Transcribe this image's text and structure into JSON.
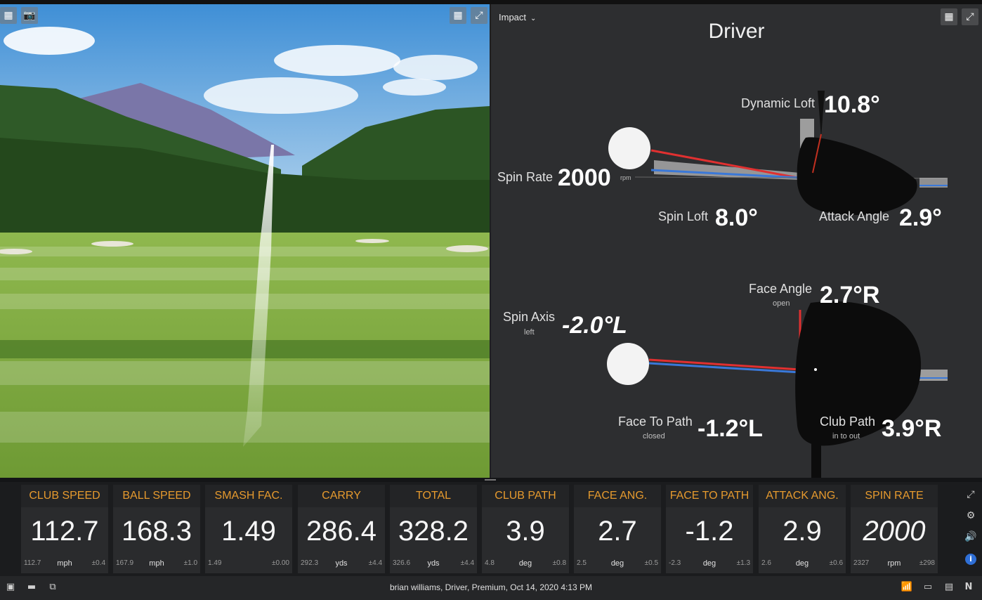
{
  "impact_panel": {
    "view_selector": "Impact",
    "club": "Driver",
    "side": {
      "dynamic_loft_label": "Dynamic Loft",
      "dynamic_loft_value": "10.8°",
      "spin_rate_label": "Spin Rate",
      "spin_rate_value": "2000",
      "spin_rate_unit": "rpm",
      "spin_loft_label": "Spin Loft",
      "spin_loft_value": "8.0°",
      "attack_angle_label": "Attack Angle",
      "attack_angle_value": "2.9°"
    },
    "top": {
      "face_angle_label": "Face Angle",
      "face_angle_sub": "open",
      "face_angle_value": "2.7°R",
      "spin_axis_label": "Spin Axis",
      "spin_axis_sub": "left",
      "spin_axis_value": "-2.0°L",
      "face_to_path_label": "Face To Path",
      "face_to_path_sub": "closed",
      "face_to_path_value": "-1.2°L",
      "club_path_label": "Club Path",
      "club_path_sub": "in to out",
      "club_path_value": "3.9°R"
    },
    "colors": {
      "face_line": "#e03030",
      "path_line": "#3a78d8",
      "panel_bg": "#2d2e30"
    }
  },
  "metrics": [
    {
      "label": "CLUB SPEED",
      "value": "112.7",
      "avg": "112.7",
      "unit": "mph",
      "dev": "±0.4"
    },
    {
      "label": "BALL SPEED",
      "value": "168.3",
      "avg": "167.9",
      "unit": "mph",
      "dev": "±1.0"
    },
    {
      "label": "SMASH FAC.",
      "value": "1.49",
      "avg": "1.49",
      "unit": "",
      "dev": "±0.00"
    },
    {
      "label": "CARRY",
      "value": "286.4",
      "avg": "292.3",
      "unit": "yds",
      "dev": "±4.4"
    },
    {
      "label": "TOTAL",
      "value": "328.2",
      "avg": "326.6",
      "unit": "yds",
      "dev": "±4.4"
    },
    {
      "label": "CLUB PATH",
      "value": "3.9",
      "avg": "4.8",
      "unit": "deg",
      "dev": "±0.8"
    },
    {
      "label": "FACE ANG.",
      "value": "2.7",
      "avg": "2.5",
      "unit": "deg",
      "dev": "±0.5"
    },
    {
      "label": "FACE TO PATH",
      "value": "-1.2",
      "avg": "-2.3",
      "unit": "deg",
      "dev": "±1.3"
    },
    {
      "label": "ATTACK ANG.",
      "value": "2.9",
      "avg": "2.6",
      "unit": "deg",
      "dev": "±0.6"
    },
    {
      "label": "SPIN RATE",
      "value": "2000",
      "avg": "2327",
      "unit": "rpm",
      "dev": "±298"
    }
  ],
  "status_bar": {
    "session_info": "brian williams, Driver, Premium, Oct 14, 2020 4:13 PM",
    "right_letter": "N"
  },
  "icons": {
    "grid": "▦",
    "camera": "📷",
    "tiles": "▦",
    "expand": "⤢",
    "settings": "⚙",
    "sound": "🔊",
    "info": "i",
    "layout1": "▣",
    "layout2": "▬",
    "layout3": "⧉",
    "chart": "📶",
    "chat": "▭",
    "doc": "▤"
  }
}
